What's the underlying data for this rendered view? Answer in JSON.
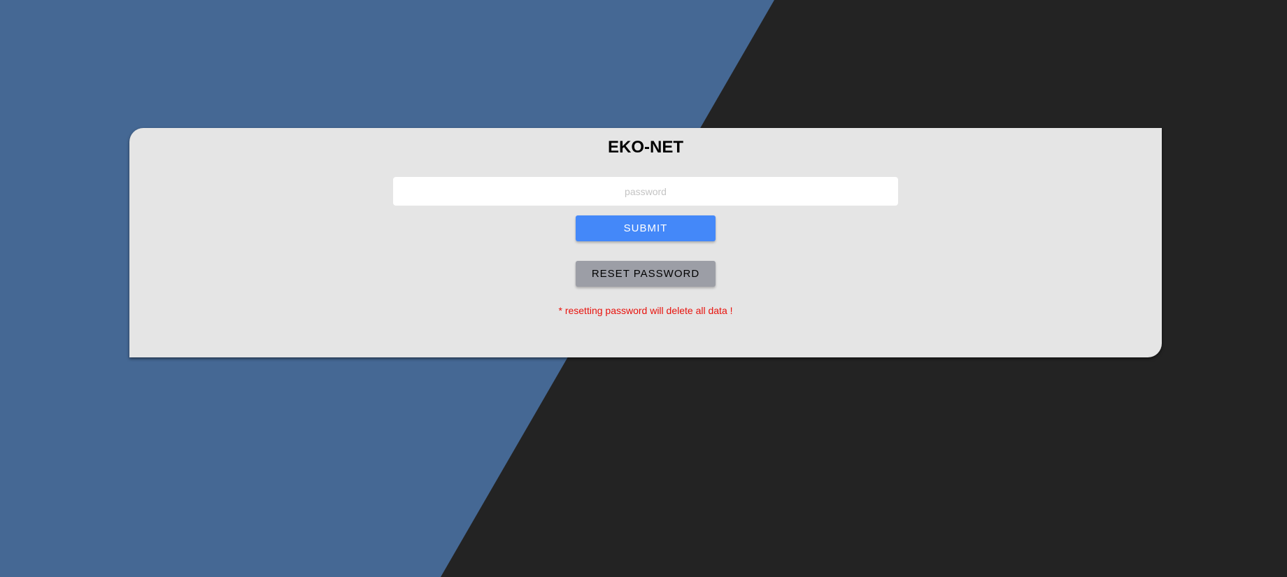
{
  "login": {
    "title": "EKO-NET",
    "password_placeholder": "password",
    "submit_label": "SUBMIT",
    "reset_label": "RESET PASSWORD",
    "warning_text": "* resetting password will delete all data !"
  },
  "colors": {
    "background_blue": "#456894",
    "background_dark": "#232323",
    "card": "#e5e5e5",
    "submit_button": "#4488f9",
    "reset_button": "#9c9ea6",
    "warning_text": "#e8120c"
  }
}
